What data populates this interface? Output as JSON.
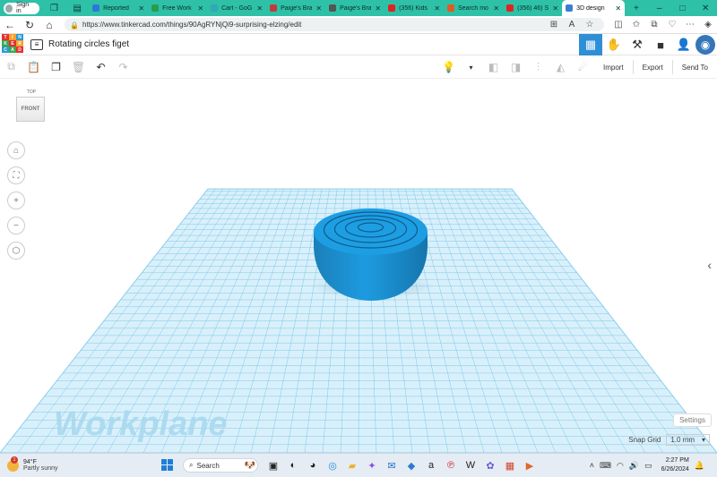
{
  "browser": {
    "signin_label": "Sign in",
    "tabs": [
      {
        "label": "Reported",
        "color": "#2a7ad4"
      },
      {
        "label": "Free Work",
        "color": "#2a9c4c"
      },
      {
        "label": "Cart - GoG",
        "color": "#2fa8b8"
      },
      {
        "label": "Paige's Bra",
        "color": "#c23b3b"
      },
      {
        "label": "Paige's Bra",
        "color": "#555555"
      },
      {
        "label": "(356) Kids",
        "color": "#e22222"
      },
      {
        "label": "Search mo",
        "color": "#e25a22"
      },
      {
        "label": "(356) 46) S",
        "color": "#e22222"
      },
      {
        "label": "3D design",
        "color": "#3a7fd6",
        "active": true
      }
    ],
    "url": "https://www.tinkercad.com/things/90AgRYNjQi9-surprising-elzing/edit"
  },
  "app": {
    "title": "Rotating circles figet",
    "logo_letters": [
      "T",
      "I",
      "N",
      "K",
      "E",
      "R",
      "C",
      "A",
      "D"
    ],
    "logo_colors": [
      "#e3312f",
      "#f7a02b",
      "#2a9ad6",
      "#3aa84a",
      "#e3312f",
      "#f7a02b",
      "#2a9ad6",
      "#3aa84a",
      "#e3312f"
    ],
    "accent": "#2e8fd6"
  },
  "toolbar": {
    "import_label": "Import",
    "export_label": "Export",
    "send_label": "Send To"
  },
  "workspace": {
    "viewcube_top": "TOP",
    "viewcube_front": "FRONT",
    "workplane_label": "Workplane",
    "settings_label": "Settings",
    "snap_label": "Snap Grid",
    "snap_value": "1.0 mm",
    "grid_color": "#8fd0ee",
    "plane_color": "#d9f0fb",
    "shape_color": "#1a93d4"
  },
  "taskbar": {
    "weather_badge": "1",
    "temperature": "94°F",
    "condition": "Partly sunny",
    "search_label": "Search",
    "time": "2:27 PM",
    "date": "6/26/2024"
  }
}
